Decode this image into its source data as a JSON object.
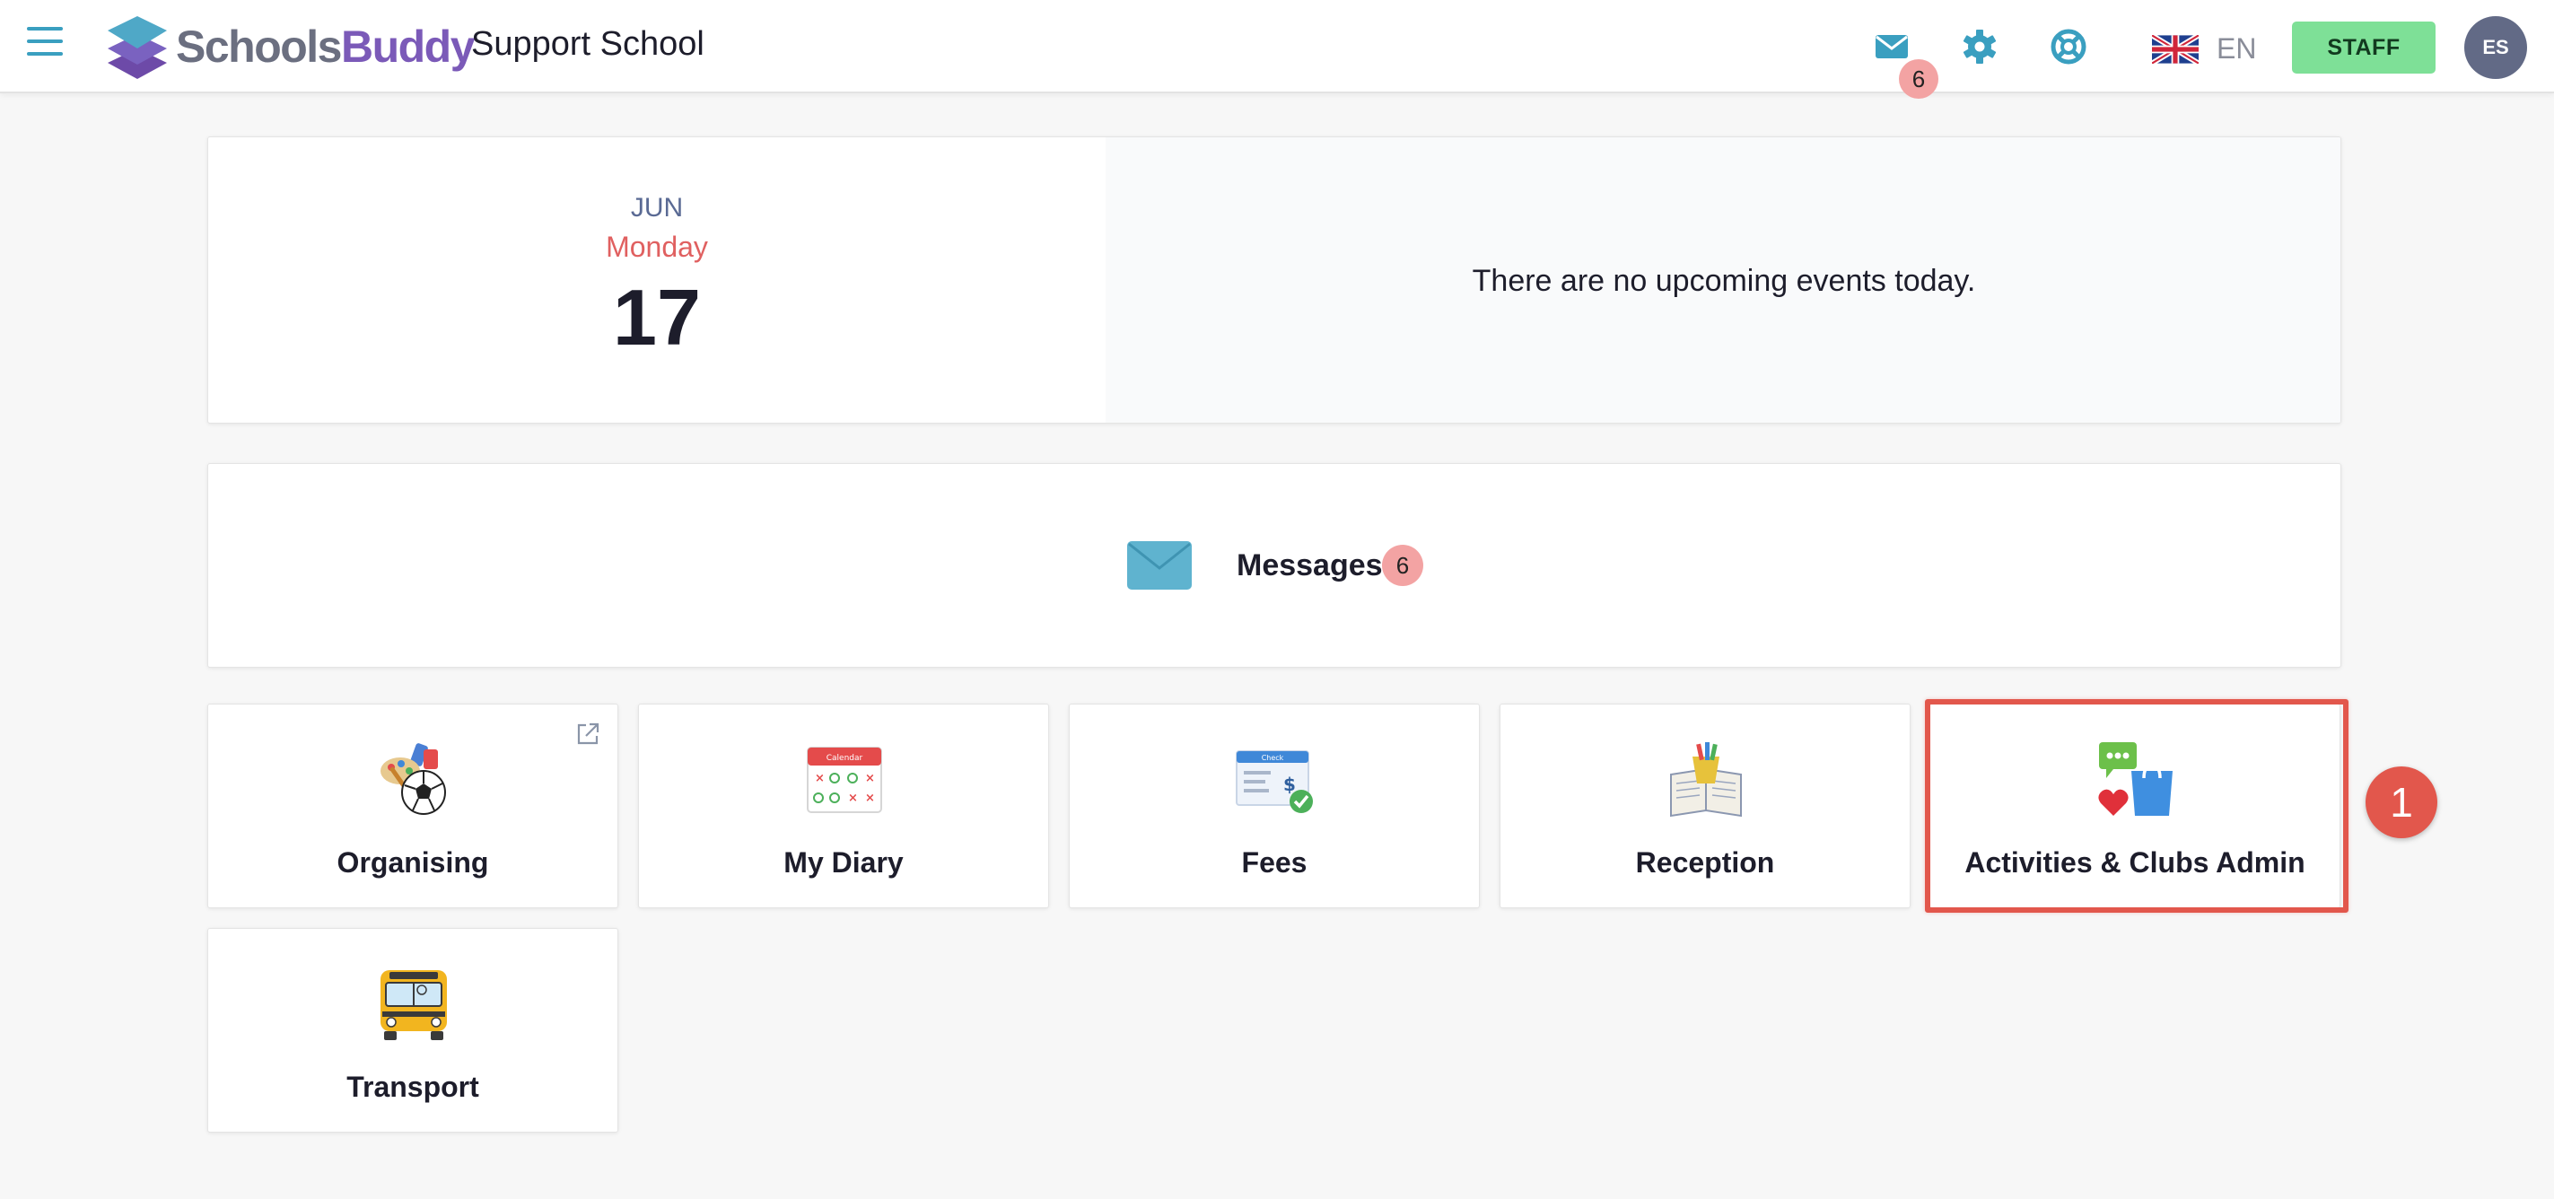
{
  "header": {
    "logo_schools": "Schools",
    "logo_buddy": "Buddy",
    "school_name": "Support School",
    "mail_badge": "6",
    "language": "EN",
    "staff_label": "STAFF",
    "avatar_initials": "ES"
  },
  "today": {
    "month": "JUN",
    "weekday": "Monday",
    "day": "17",
    "events_message": "There are no upcoming events today."
  },
  "messages": {
    "label": "Messages",
    "count": "6"
  },
  "tiles": [
    {
      "label": "Organising",
      "icon": "organising-icon"
    },
    {
      "label": "My Diary",
      "icon": "calendar-icon"
    },
    {
      "label": "Fees",
      "icon": "cheque-icon"
    },
    {
      "label": "Reception",
      "icon": "reception-icon"
    },
    {
      "label": "Activities & Clubs Admin",
      "icon": "activities-icon"
    },
    {
      "label": "Transport",
      "icon": "school-bus-icon"
    }
  ],
  "annotation": {
    "step_number": "1"
  },
  "colors": {
    "accent": "#3a9fc0",
    "brand_purple": "#7b5ab8",
    "staff_green": "#7ee097",
    "badge_pink": "#f3a3a3",
    "highlight_red": "#e2574c"
  }
}
